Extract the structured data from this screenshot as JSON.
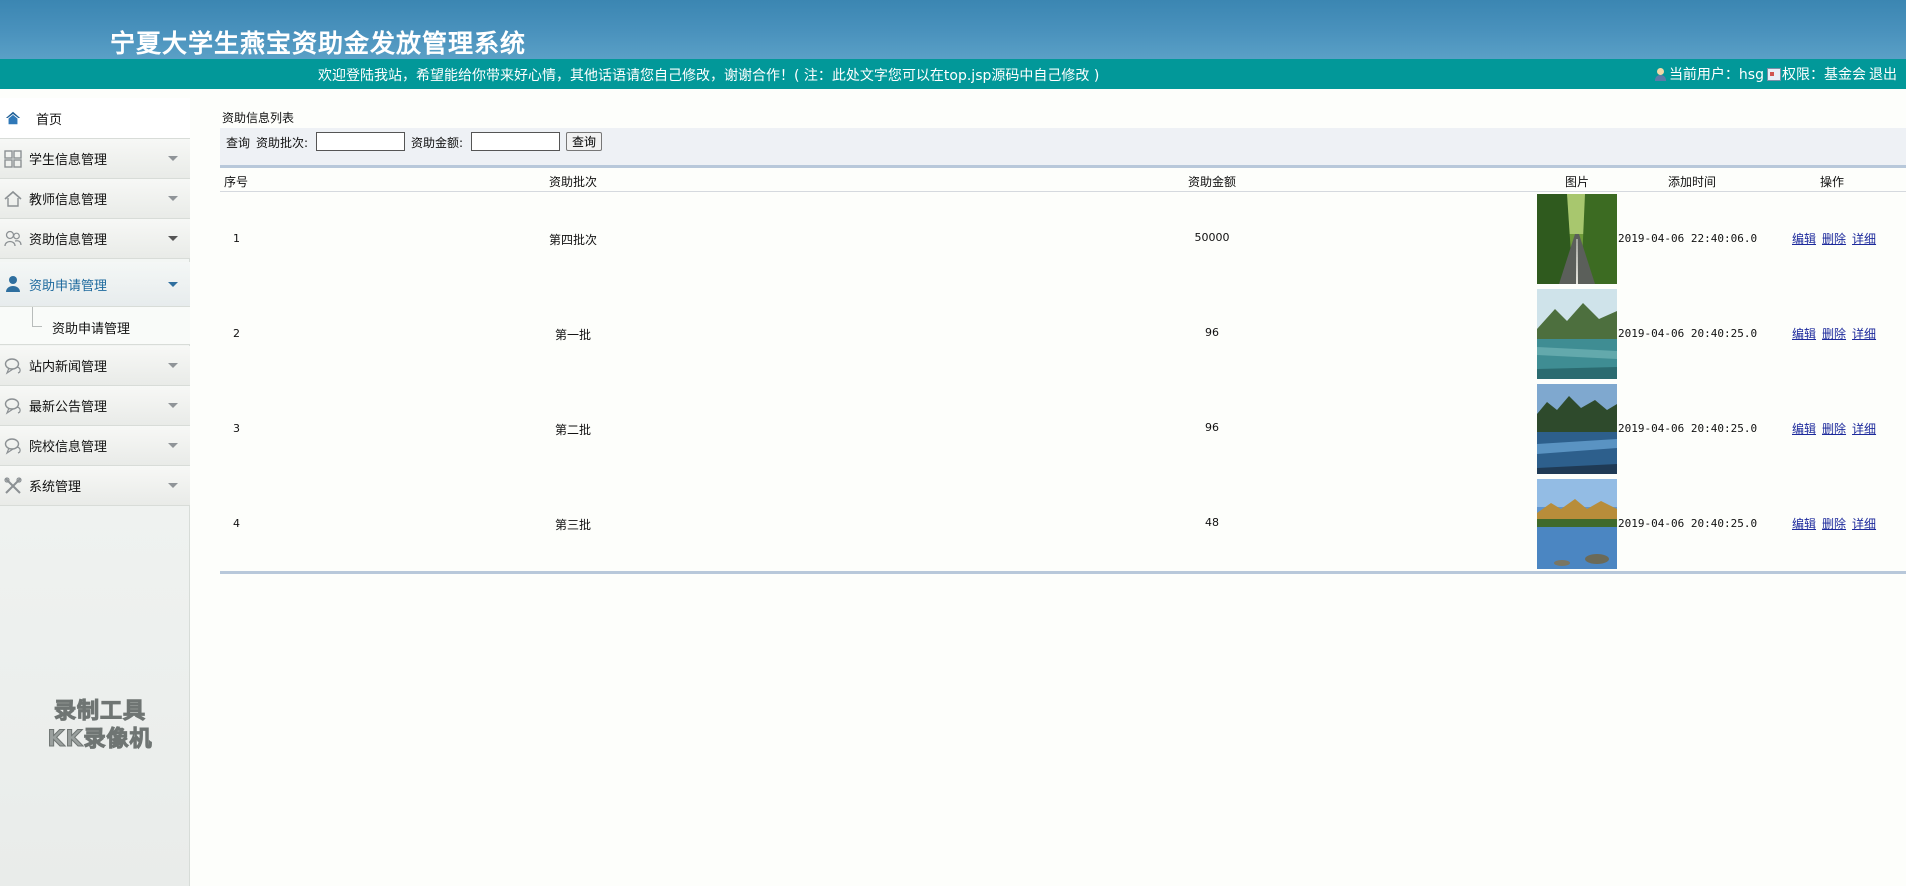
{
  "header": {
    "title": "宁夏大学生燕宝资助金发放管理系统",
    "welcome": "欢迎登陆我站，希望能给你带来好心情，其他话语请您自己修改，谢谢合作！( 注：此处文字您可以在top.jsp源码中自己修改 )",
    "user_label": "当前用户：hsg",
    "role_label": "权限：基金会",
    "logout": "退出"
  },
  "sidebar": {
    "items": [
      {
        "label": "首页",
        "icon": "home-icon"
      },
      {
        "label": "学生信息管理",
        "icon": "grid-icon"
      },
      {
        "label": "教师信息管理",
        "icon": "house-icon"
      },
      {
        "label": "资助信息管理",
        "icon": "users-icon"
      },
      {
        "label": "资助申请管理",
        "icon": "user-icon"
      },
      {
        "label": "站内新闻管理",
        "icon": "chat-icon"
      },
      {
        "label": "最新公告管理",
        "icon": "chat-icon"
      },
      {
        "label": "院校信息管理",
        "icon": "chat-icon"
      },
      {
        "label": "系统管理",
        "icon": "tools-icon"
      }
    ],
    "sub_item": "资助申请管理",
    "watermark_line1": "录制工具",
    "watermark_line2": "KK录像机"
  },
  "main": {
    "panel_title": "资助信息列表",
    "search": {
      "prefix": "查询",
      "batch_label": "资助批次:",
      "amount_label": "资助金额:",
      "batch_value": "",
      "amount_value": "",
      "button": "查询"
    },
    "table": {
      "headers": [
        "序号",
        "资助批次",
        "资助金额",
        "图片",
        "添加时间",
        "操作"
      ],
      "rows": [
        {
          "no": "1",
          "batch": "第四批次",
          "amount": "50000",
          "time": "2019-04-06 22:40:06.0",
          "image": "tree-lined-road"
        },
        {
          "no": "2",
          "batch": "第一批",
          "amount": "96",
          "time": "2019-04-06 20:40:25.0",
          "image": "mountain-lake"
        },
        {
          "no": "3",
          "batch": "第二批",
          "amount": "96",
          "time": "2019-04-06 20:40:25.0",
          "image": "river-landscape"
        },
        {
          "no": "4",
          "batch": "第三批",
          "amount": "48",
          "time": "2019-04-06 20:40:25.0",
          "image": "lake-reflection"
        }
      ],
      "ops": {
        "edit": "编辑",
        "delete": "删除",
        "detail": "详细"
      }
    }
  }
}
